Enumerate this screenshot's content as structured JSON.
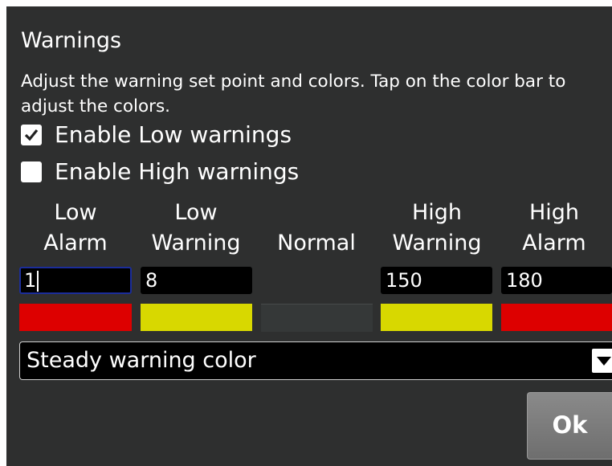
{
  "dialog": {
    "title": "Warnings",
    "description": "Adjust the warning set point and colors. Tap on the color bar to adjust the colors."
  },
  "options": {
    "enable_low": {
      "label": "Enable Low warnings",
      "checked": true
    },
    "enable_high": {
      "label": "Enable High warnings",
      "checked": false
    }
  },
  "columns": [
    {
      "line1": "Low",
      "line2": "Alarm"
    },
    {
      "line1": "Low",
      "line2": "Warning"
    },
    {
      "line1": "",
      "line2": "Normal"
    },
    {
      "line1": "High",
      "line2": "Warning"
    },
    {
      "line1": "High",
      "line2": "Alarm"
    }
  ],
  "fields": {
    "low_alarm": "1",
    "low_warning": "8",
    "high_warning": "150",
    "high_alarm": "180"
  },
  "colors": {
    "low_alarm": "#dd0000",
    "low_warning": "#d8d800",
    "normal": "#353838",
    "high_warning": "#d8d800",
    "high_alarm": "#dd0000"
  },
  "dropdown": {
    "selected": "Steady warning color"
  },
  "ok_label": "Ok"
}
